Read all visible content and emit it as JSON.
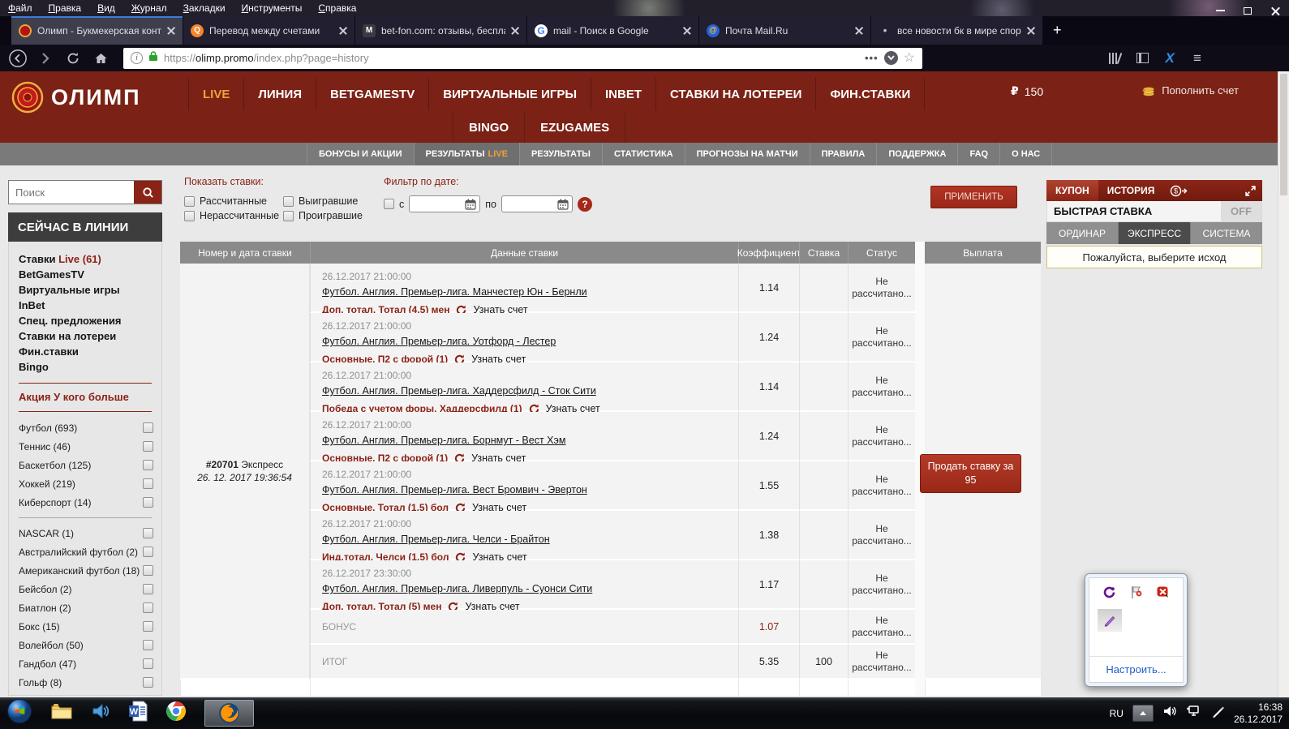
{
  "colors": {
    "header_maroon": "#7b2115",
    "accent_red": "#8b2216",
    "live_orange": "#f0a13b",
    "subnav_gray": "#7a7a7a"
  },
  "os": {
    "menu": [
      "Файл",
      "Правка",
      "Вид",
      "Журнал",
      "Закладки",
      "Инструменты",
      "Справка"
    ]
  },
  "browser": {
    "tabs": [
      {
        "title": "Олимп - Букмекерская контор"
      },
      {
        "title": "Перевод между счетами",
        "glyph": "Q"
      },
      {
        "title": "bet-fon.com: отзывы, бесплат",
        "glyph": "M"
      },
      {
        "title": "mail - Поиск в Google",
        "glyph": "G"
      },
      {
        "title": "Почта Mail.Ru",
        "glyph": "@"
      },
      {
        "title": "все новости бк в мире спорта",
        "glyph": "•"
      }
    ],
    "new_tab_label": "+",
    "url": {
      "protocol": "https://",
      "domain": "olimp.promo",
      "path": "/index.php?page=history"
    }
  },
  "site": {
    "logo": "ОЛИМП",
    "nav1": [
      "LIVE",
      "ЛИНИЯ",
      "BETGAMESTV",
      "ВИРТУАЛЬНЫЕ ИГРЫ",
      "INBET",
      "СТАВКИ НА ЛОТЕРЕИ",
      "ФИН.СТАВКИ"
    ],
    "nav2": [
      "BINGO",
      "EZUGAMES"
    ],
    "balance": {
      "currency": "₽",
      "amount": "150"
    },
    "topup": "Пополнить счет"
  },
  "subnav": {
    "items": [
      "БОНУСЫ И АКЦИИ",
      "РЕЗУЛЬТАТЫ",
      "РЕЗУЛЬТАТЫ",
      "СТАТИСТИКА",
      "ПРОГНОЗЫ НА МАТЧИ",
      "ПРАВИЛА",
      "ПОДДЕРЖКА",
      "FAQ",
      "О НАС"
    ],
    "live": "LIVE"
  },
  "sidebar": {
    "search_placeholder": "Поиск",
    "section_title": "СЕЙЧАС В ЛИНИИ",
    "live_link": {
      "prefix": "Ставки",
      "label": "Live (61)"
    },
    "links": [
      "BetGamesTV",
      "Виртуальные игры",
      "InBet",
      "Спец. предложения",
      "Ставки на лотереи",
      "Фин.ставки",
      "Bingo"
    ],
    "promo": "Акция У кого больше",
    "sports1": [
      "Футбол (693)",
      "Теннис (46)",
      "Баскетбол (125)",
      "Хоккей (219)",
      "Киберспорт (14)"
    ],
    "sports2": [
      "NASCAR (1)",
      "Австралийский футбол (2)",
      "Американский футбол (18)",
      "Бейсбол (2)",
      "Биатлон (2)",
      "Бокс (15)",
      "Волейбол (50)",
      "Гандбол (47)",
      "Гольф (8)"
    ]
  },
  "filters": {
    "show_title": "Показать ставки:",
    "options": [
      "Рассчитанные",
      "Нерассчитанные",
      "Выигравшие",
      "Проигравшие"
    ],
    "date_title": "Фильтр по дате:",
    "from": "с",
    "to": "по",
    "help": "?",
    "apply": "ПРИМЕНИТЬ"
  },
  "history": {
    "headers": [
      "Номер и дата ставки",
      "Данные ставки",
      "Коэффициент",
      "Ставка",
      "Статус",
      "Выплата"
    ],
    "entry": {
      "id": "#20701",
      "kind": "Экспресс",
      "placed": "26. 12. 2017 19:36:54"
    },
    "bets": [
      {
        "date": "26.12.2017 21:00:00",
        "event": "Футбол. Англия. Премьер-лига. Манчестер Юн - Бернли",
        "pick": "Доп. тотал. Тотал (4.5) мен",
        "coef": "1.14"
      },
      {
        "date": "26.12.2017 21:00:00",
        "event": "Футбол. Англия. Премьер-лига. Уотфорд - Лестер",
        "pick": "Основные. П2 с форой (1)",
        "coef": "1.24"
      },
      {
        "date": "26.12.2017 21:00:00",
        "event": "Футбол. Англия. Премьер-лига. Хаддерсфилд - Сток Сити",
        "pick": "Победа с учетом форы. Хаддерсфилд (1)",
        "coef": "1.14"
      },
      {
        "date": "26.12.2017 21:00:00",
        "event": "Футбол. Англия. Премьер-лига. Борнмут - Вест Хэм",
        "pick": "Основные. П2 с форой (1)",
        "coef": "1.24"
      },
      {
        "date": "26.12.2017 21:00:00",
        "event": "Футбол. Англия. Премьер-лига. Вест Бромвич - Эвертон",
        "pick": "Основные. Тотал (1.5) бол",
        "coef": "1.55"
      },
      {
        "date": "26.12.2017 21:00:00",
        "event": "Футбол. Англия. Премьер-лига. Челси - Брайтон",
        "pick": "Инд.тотал. Челси (1.5) бол",
        "coef": "1.38"
      },
      {
        "date": "26.12.2017 23:30:00",
        "event": "Футбол. Англия. Премьер-лига. Ливерпуль - Суонси Сити",
        "pick": "Доп. тотал. Тотал (5) мен",
        "coef": "1.17"
      }
    ],
    "shared": {
      "score_link": "Узнать счет",
      "status": "Не рассчитано..."
    },
    "bonus": {
      "label": "БОНУС",
      "coef": "1.07"
    },
    "total": {
      "label": "ИТОГ",
      "coef": "5.35",
      "stake": "100"
    },
    "sell": {
      "line1": "Продать ставку за",
      "amount": "95"
    }
  },
  "coupon": {
    "tab_coupon": "КУПОН",
    "tab_history": "ИСТОРИЯ",
    "quick": "БЫСТРАЯ СТАВКА",
    "off": "OFF",
    "modes": [
      "ОРДИНАР",
      "ЭКСПРЕСС",
      "СИСТЕМА"
    ],
    "message": "Пожалуйста, выберите исход"
  },
  "tray": {
    "customize": "Настроить..."
  },
  "taskbar": {
    "lang": "RU",
    "time": "16:38",
    "date": "26.12.2017"
  }
}
